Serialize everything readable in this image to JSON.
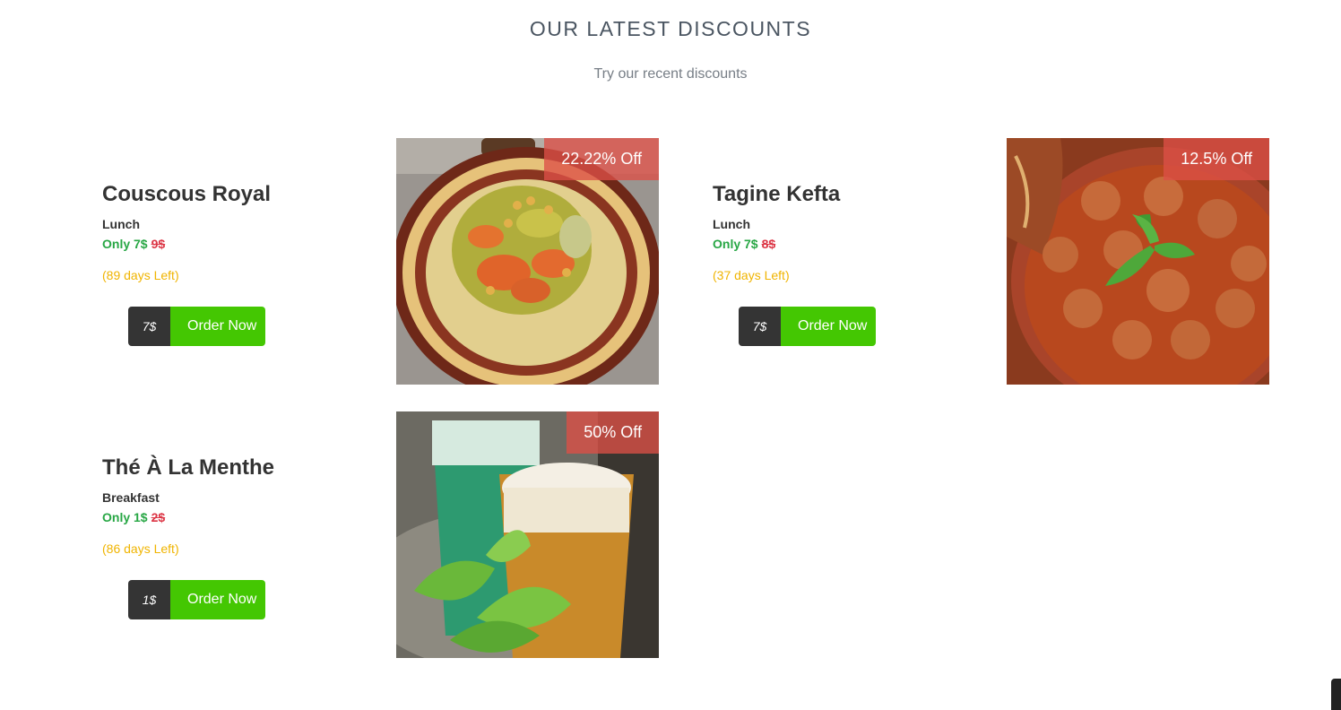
{
  "section": {
    "title": "OUR LATEST DISCOUNTS",
    "subtitle": "Try our recent discounts"
  },
  "colors": {
    "accent_green": "#44c702",
    "price_green": "#28a745",
    "old_price_red": "#dc3545",
    "days_yellow": "#f0b400",
    "price_box_dark": "#343434",
    "badge_red": "#dc5046"
  },
  "discounts": [
    {
      "name": "Couscous Royal",
      "category": "Lunch",
      "only_label": "Only 7$",
      "old_price": "9$",
      "days_left": "(89 days Left)",
      "price_tag": "7$",
      "order_label": "Order Now",
      "badge": "22.22% Off",
      "image_icon": "couscous-dish-image"
    },
    {
      "name": "Tagine Kefta",
      "category": "Lunch",
      "only_label": "Only 7$",
      "old_price": "8$",
      "days_left": "(37 days Left)",
      "price_tag": "7$",
      "order_label": "Order Now",
      "badge": "12.5% Off",
      "image_icon": "tagine-dish-image"
    },
    {
      "name": "Thé À La Menthe",
      "category": "Breakfast",
      "only_label": "Only 1$",
      "old_price": "2$",
      "days_left": "(86 days Left)",
      "price_tag": "1$",
      "order_label": "Order Now",
      "badge": "50% Off",
      "image_icon": "mint-tea-image"
    }
  ]
}
